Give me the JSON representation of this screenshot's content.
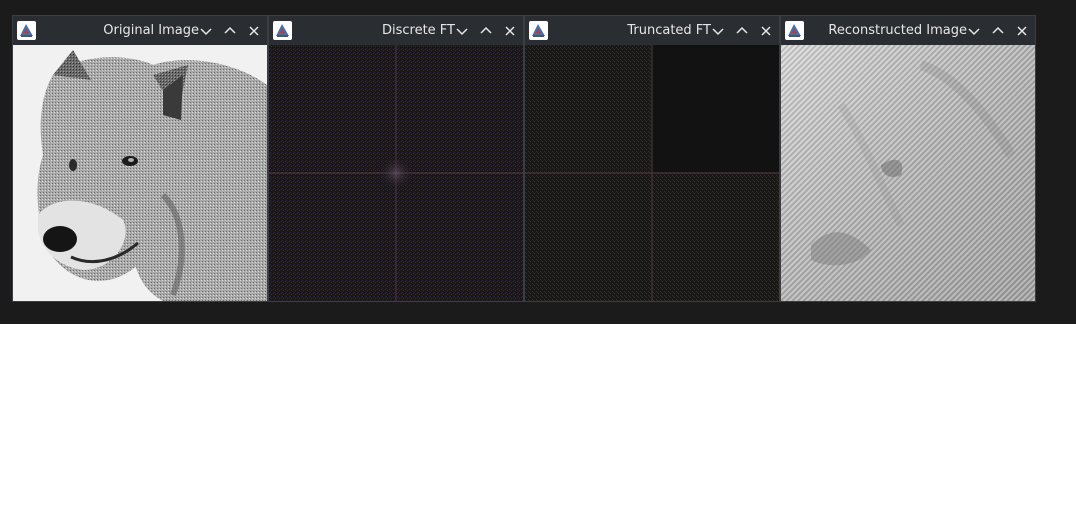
{
  "windows": [
    {
      "title": "Original Image",
      "content": "wolf photograph (grayscale)"
    },
    {
      "title": "Discrete FT",
      "content": "Fourier spectrum"
    },
    {
      "title": "Truncated FT",
      "content": "truncated Fourier spectrum"
    },
    {
      "title": "Reconstructed Image",
      "content": "reconstructed image"
    }
  ],
  "icons": {
    "app": "java-app-icon",
    "minimize": "chevron-down-icon",
    "maximize": "chevron-up-icon",
    "close": "close-icon"
  },
  "colors": {
    "desktop": "#1b1b1b",
    "titlebar": "#2a2d32",
    "title_text": "#e6e6e6",
    "spectrum_bg": "#1a1717"
  }
}
